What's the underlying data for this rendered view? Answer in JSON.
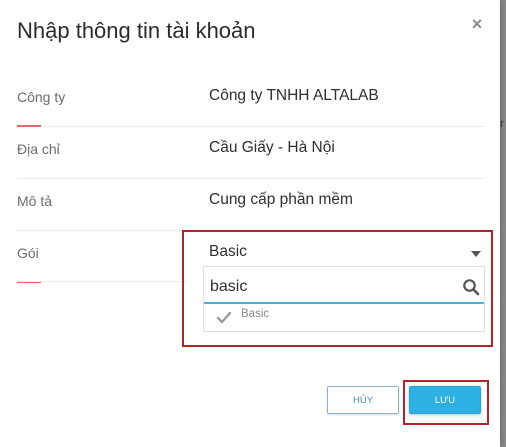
{
  "dialog": {
    "title": "Nhập thông tin tài khoản",
    "close_symbol": "×"
  },
  "form": {
    "company": {
      "label": "Công ty",
      "value": "Công ty TNHH ALTALAB"
    },
    "address": {
      "label": "Địa chỉ",
      "value": "Cầu Giấy - Hà Nội"
    },
    "description": {
      "label": "Mô tả",
      "value": "Cung cấp phần mềm"
    },
    "package": {
      "label": "Gói",
      "selected": "Basic",
      "search_value": "basic",
      "options": [
        {
          "label": "Basic",
          "checked": true
        }
      ]
    }
  },
  "buttons": {
    "cancel_label": "HỦY",
    "save_label": "LƯU"
  },
  "colors": {
    "label_accent": "#e26a6a",
    "input_underline": "#3db6dd",
    "primary_button": "#2db0e3",
    "highlight_border": "#b0242a"
  },
  "icons": [
    "close-icon",
    "chevron-down-icon",
    "search-icon",
    "check-icon"
  ]
}
